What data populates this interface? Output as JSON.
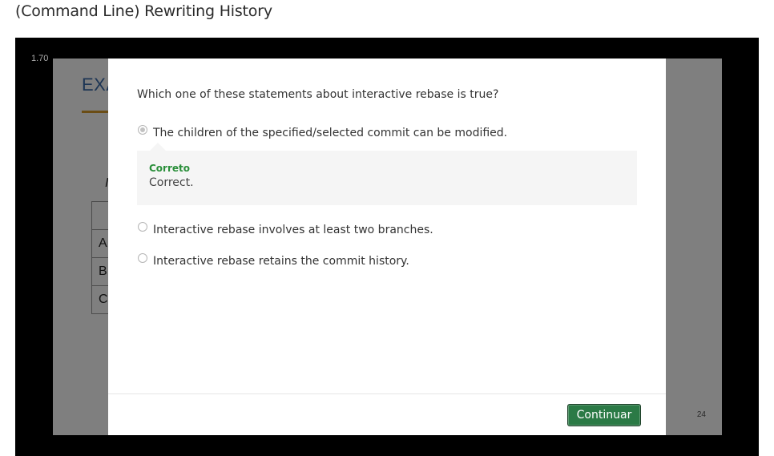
{
  "page": {
    "title": "(Command Line) Rewriting History"
  },
  "player": {
    "speed": "1.70",
    "slide": {
      "heading": "EXA",
      "letter": "I",
      "rows": [
        "A",
        "B",
        "C"
      ],
      "page_number": "24"
    }
  },
  "modal": {
    "question": "Which one of these statements about interactive rebase is true?",
    "options": [
      {
        "label": "The children of the specified/selected commit can be modified.",
        "selected": true
      },
      {
        "label": "Interactive rebase involves at least two branches.",
        "selected": false
      },
      {
        "label": "Interactive rebase retains the commit history.",
        "selected": false
      }
    ],
    "feedback": {
      "title": "Correto",
      "text": "Correct."
    },
    "continue_label": "Continuar"
  },
  "colors": {
    "accent_green": "#2b7a46",
    "feedback_title": "#2a8f3a",
    "player_background": "#000000"
  }
}
